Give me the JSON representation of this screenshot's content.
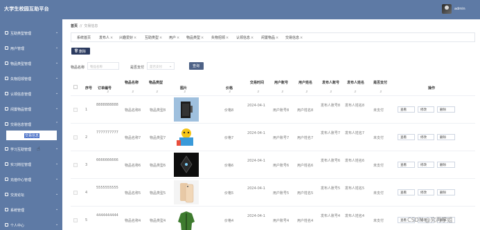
{
  "app": {
    "title": "大学生校园互助平台",
    "username": "admin"
  },
  "sidebar": {
    "items": [
      {
        "label": "互助类型管理",
        "icon": "grid-icon"
      },
      {
        "label": "用户管理",
        "icon": "user-icon"
      },
      {
        "label": "物品类型管理",
        "icon": "box-icon"
      },
      {
        "label": "失物招领管理",
        "icon": "search-icon"
      },
      {
        "label": "认领信息管理",
        "icon": "file-icon"
      },
      {
        "label": "闲置物品管理",
        "icon": "archive-icon"
      },
      {
        "label": "交易信息管理",
        "icon": "user-icon"
      },
      {
        "label": "学习互助管理",
        "icon": "book-icon"
      },
      {
        "label": "实习岗位管理",
        "icon": "briefcase-icon"
      },
      {
        "label": "充值中心管理",
        "icon": "wallet-icon"
      },
      {
        "label": "交流论坛",
        "icon": "chat-icon"
      },
      {
        "label": "系统管理",
        "icon": "gear-icon"
      },
      {
        "label": "个人中心",
        "icon": "person-icon"
      }
    ],
    "active_sub": "交易信息"
  },
  "breadcrumb": {
    "home": "首页",
    "sep": "//",
    "current": "交易信息"
  },
  "tabs": [
    "系统首页",
    "发布人",
    "兴趣爱好",
    "互助类型",
    "用户",
    "物品类型",
    "失物招领",
    "认领信息",
    "闲置物品",
    "交易信息"
  ],
  "toolbar": {
    "delete_label": "删除"
  },
  "search": {
    "name_label": "物品名称",
    "name_placeholder": "物品名称",
    "paid_label": "是否支付",
    "paid_placeholder": "是否支付",
    "button": "查询"
  },
  "table": {
    "headers": [
      "序号",
      "订单编号",
      "物品名称",
      "物品类型",
      "图片",
      "价格",
      "交易时间",
      "用户账号",
      "用户姓名",
      "发布人账号",
      "发布人姓名",
      "是否支付",
      "操作"
    ],
    "rows": [
      {
        "index": "1",
        "order": "8888888888",
        "name": "物品名称8",
        "type": "物品类型8",
        "price": "价格8",
        "date": "2024-04-1",
        "account": "用户账号8",
        "uname": "用户姓名8",
        "pub_acc": "发布人账号8",
        "pub_name": "发布人姓名8",
        "paid": "未支付",
        "image": "speaker"
      },
      {
        "index": "2",
        "order": "7777777777",
        "name": "物品名称7",
        "type": "物品类型7",
        "price": "价格7",
        "date": "2024-04-1",
        "account": "用户账号7",
        "uname": "用户姓名7",
        "pub_acc": "发布人账号7",
        "pub_name": "发布人姓名7",
        "paid": "未支付",
        "image": "cartoon"
      },
      {
        "index": "3",
        "order": "6666666666",
        "name": "物品名称6",
        "type": "物品类型6",
        "price": "价格6",
        "date": "2024-04-1",
        "account": "用户账号6",
        "uname": "用户姓名6",
        "pub_acc": "发布人账号6",
        "pub_name": "发布人姓名6",
        "paid": "未支付",
        "image": "dark-device"
      },
      {
        "index": "4",
        "order": "5555555555",
        "name": "物品名称5",
        "type": "物品类型5",
        "price": "价格5",
        "date": "2024-04-1",
        "account": "用户账号5",
        "uname": "用户姓名5",
        "pub_acc": "发布人账号5",
        "pub_name": "发布人姓名5",
        "paid": "未支付",
        "image": "phone"
      },
      {
        "index": "5",
        "order": "4444444444",
        "name": "物品名称4",
        "type": "物品类型4",
        "price": "价格4",
        "date": "2024-04-1",
        "account": "用户账号4",
        "uname": "用户姓名4",
        "pub_acc": "发布人账号4",
        "pub_name": "发布人姓名4",
        "paid": "未支付",
        "image": "jacket"
      }
    ],
    "actions": {
      "view": "查看",
      "edit": "修改",
      "delete": "删除"
    }
  },
  "watermark": "CSDN @究再学姐",
  "colors": {
    "sidebar": "#5e7aa5",
    "active": "#4a70c7",
    "button": "#2b3a5f"
  }
}
